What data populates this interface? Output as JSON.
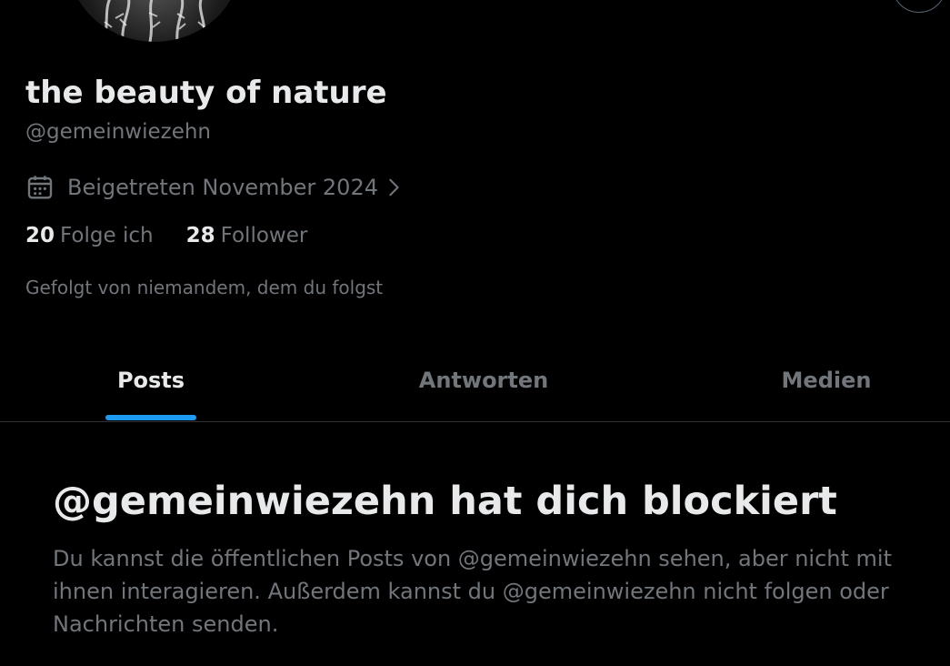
{
  "profile": {
    "display_name": "the beauty of nature",
    "handle": "@gemeinwiezehn",
    "joined": "Beigetreten November 2024",
    "following_count": "20",
    "following_label": "Folge ich",
    "followers_count": "28",
    "followers_label": "Follower",
    "followed_by": "Gefolgt von niemandem, dem du folgst"
  },
  "tabs": [
    {
      "label": "Posts",
      "active": true
    },
    {
      "label": "Antworten",
      "active": false
    },
    {
      "label": "Medien",
      "active": false
    }
  ],
  "blocked": {
    "title": "@gemeinwiezehn hat dich blockiert",
    "message": "Du kannst die öffentlichen Posts von @gemeinwiezehn sehen, aber nicht mit ihnen interagieren. Außerdem kannst du @gemeinwiezehn nicht folgen oder Nachrichten senden."
  },
  "icons": {
    "calendar": "calendar-icon",
    "chevron": "chevron-right-icon"
  },
  "colors": {
    "background": "#000000",
    "primary_text": "#e7e9ea",
    "secondary_text": "#71767b",
    "accent": "#1d9bf0",
    "divider": "#2f3336"
  }
}
